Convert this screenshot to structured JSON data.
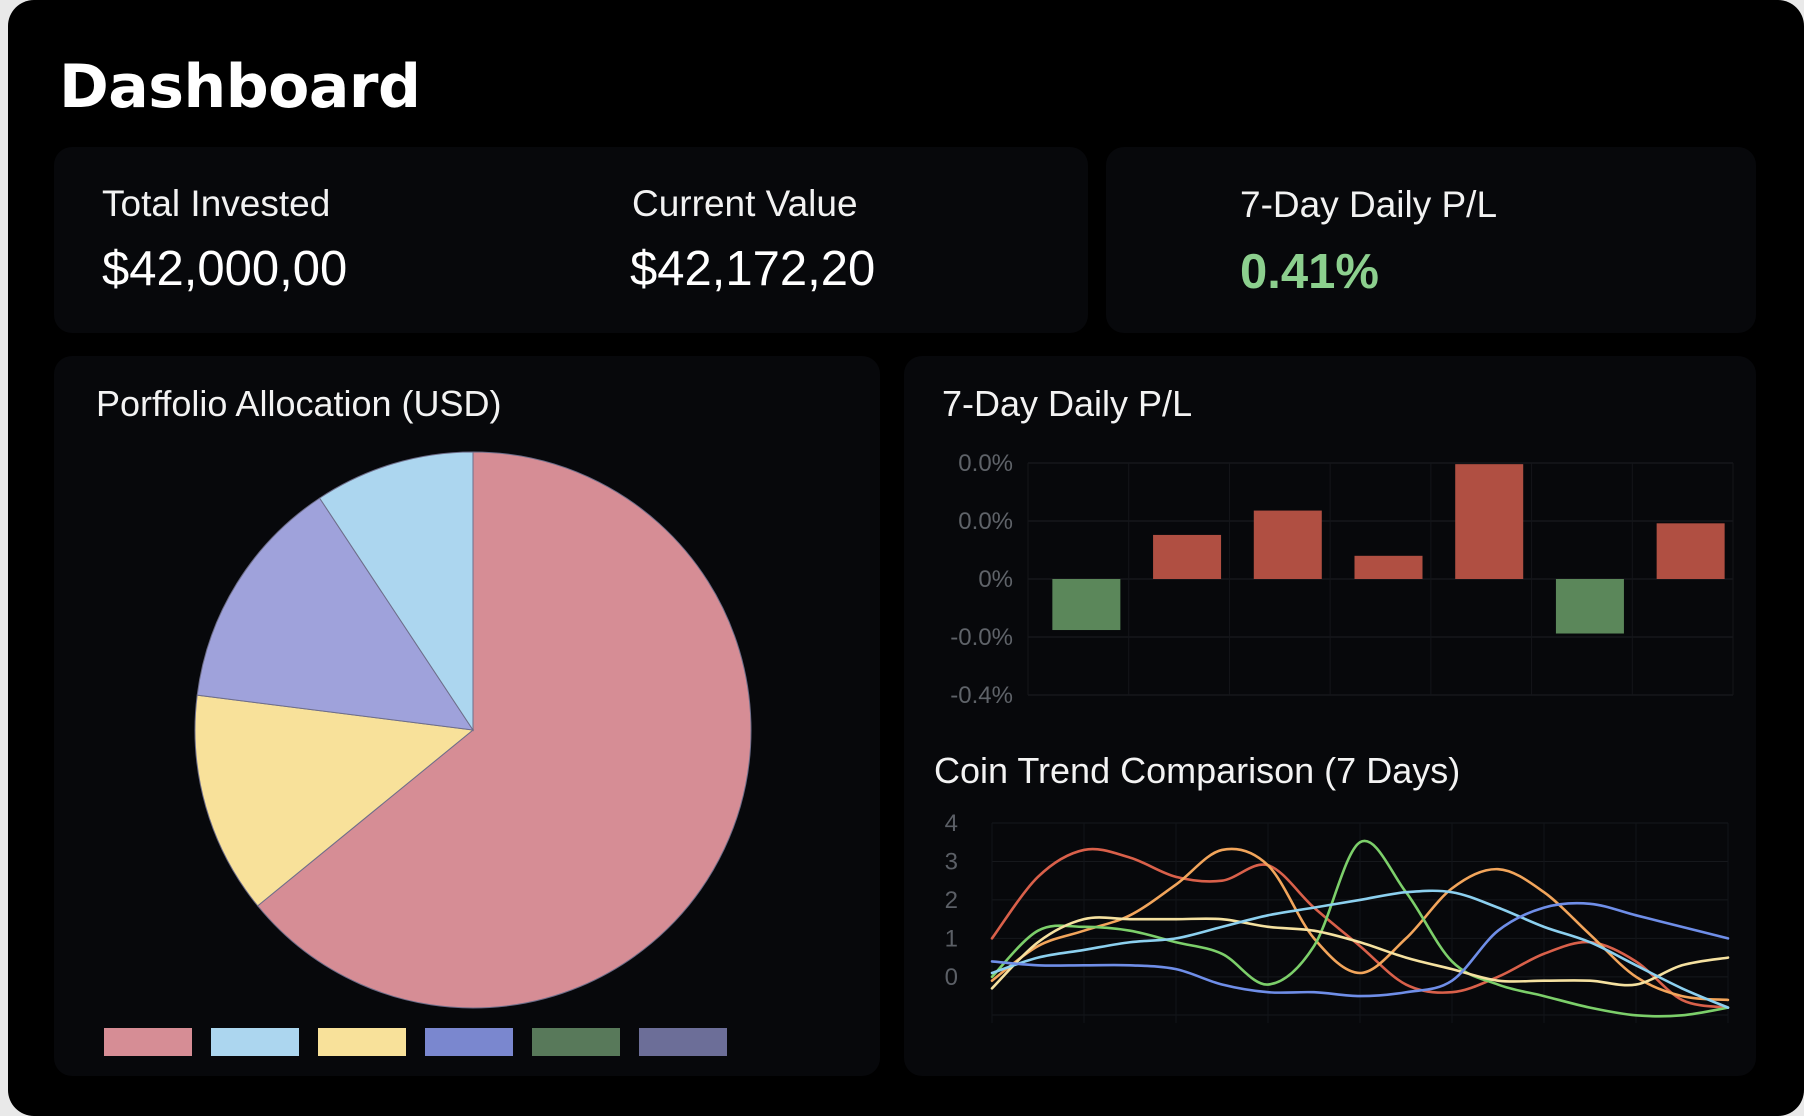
{
  "page": {
    "title": "Dashboard"
  },
  "stats": {
    "total_invested": {
      "label": "Total Invested",
      "value": "$42,000,00"
    },
    "current_value": {
      "label": "Current Value",
      "value": "$42,172,20"
    },
    "daily_pl": {
      "label": "7-Day Daily P/L",
      "value": "0.41%",
      "color": "#8ccf8e"
    }
  },
  "allocation": {
    "title": "Porffolio Allocation (USD)",
    "legend": [
      {
        "color": "#d68d95"
      },
      {
        "color": "#acd6ef"
      },
      {
        "color": "#f8e19a"
      },
      {
        "color": "#7a87cf"
      },
      {
        "color": "#58795a"
      },
      {
        "color": "#6c6e98"
      }
    ]
  },
  "daily_chart": {
    "title": "7-Day Daily P/L"
  },
  "trend_chart": {
    "title": "Coin Trend Comparison (7 Days)"
  },
  "chart_data": [
    {
      "type": "pie",
      "title": "Porffolio Allocation (USD)",
      "values": [
        64.1,
        12.9,
        13.7,
        9.3
      ],
      "colors": [
        "#d68d95",
        "#f8e19a",
        "#9fa2db",
        "#acd6ef"
      ]
    },
    {
      "type": "bar",
      "title": "7-Day Daily P/L",
      "ytick_labels": [
        "0.0%",
        "0.0%",
        "0%",
        "-0.0%",
        "-0.4%"
      ],
      "ylim": [
        -0.2,
        0.2
      ],
      "values": [
        -0.088,
        0.076,
        0.118,
        0.04,
        0.198,
        -0.094,
        0.096
      ],
      "pos_color": "#b04f42",
      "neg_color": "#5b875a"
    },
    {
      "type": "line",
      "title": "Coin Trend Comparison (7 Days)",
      "yticks": [
        "4",
        "3",
        "2",
        "1",
        "0"
      ],
      "ylim": [
        -1.2,
        4
      ],
      "x": [
        0,
        1,
        2,
        3,
        4,
        5,
        6,
        7,
        8,
        9,
        10,
        11,
        12,
        13,
        14,
        15,
        16
      ],
      "series": [
        {
          "color": "#d9604a",
          "values": [
            1.0,
            2.6,
            3.3,
            3.1,
            2.6,
            2.5,
            2.9,
            1.8,
            0.8,
            -0.2,
            -0.4,
            0.0,
            0.6,
            0.9,
            0.4,
            -0.6,
            -0.8
          ]
        },
        {
          "color": "#f2a55b",
          "values": [
            -0.1,
            0.8,
            1.2,
            1.6,
            2.4,
            3.3,
            2.9,
            1.0,
            0.1,
            1.0,
            2.3,
            2.8,
            2.2,
            1.1,
            0.0,
            -0.5,
            -0.6
          ]
        },
        {
          "color": "#7ccf6a",
          "values": [
            0.0,
            1.2,
            1.3,
            1.2,
            0.9,
            0.6,
            -0.2,
            0.8,
            3.5,
            2.2,
            0.4,
            -0.2,
            -0.5,
            -0.8,
            -1.0,
            -1.0,
            -0.8
          ]
        },
        {
          "color": "#f5e1a0",
          "values": [
            -0.3,
            0.9,
            1.5,
            1.5,
            1.5,
            1.5,
            1.3,
            1.2,
            0.9,
            0.5,
            0.2,
            -0.1,
            -0.1,
            -0.1,
            -0.2,
            0.3,
            0.5
          ]
        },
        {
          "color": "#8cd0ef",
          "values": [
            0.1,
            0.5,
            0.7,
            0.9,
            1.0,
            1.3,
            1.6,
            1.8,
            2.0,
            2.2,
            2.2,
            1.8,
            1.3,
            0.9,
            0.3,
            -0.3,
            -0.8
          ]
        },
        {
          "color": "#6f8ee8",
          "values": [
            0.4,
            0.3,
            0.3,
            0.3,
            0.2,
            -0.2,
            -0.4,
            -0.4,
            -0.5,
            -0.4,
            -0.1,
            1.2,
            1.8,
            1.9,
            1.6,
            1.3,
            1.0
          ]
        }
      ]
    }
  ]
}
